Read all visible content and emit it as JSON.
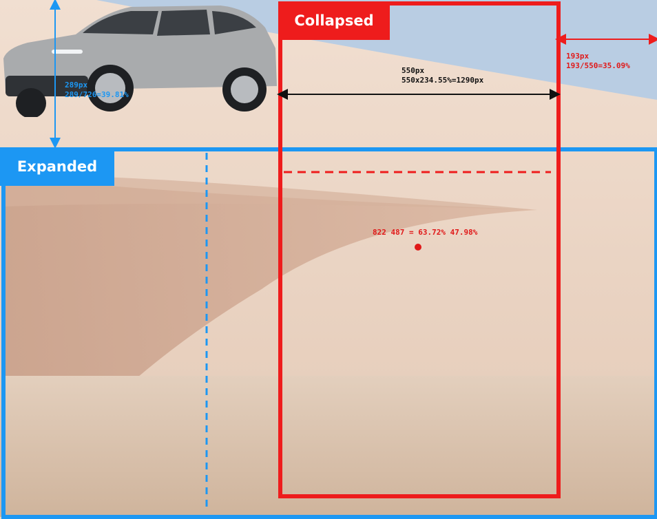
{
  "labels": {
    "collapsed": "Collapsed",
    "expanded": "Expanded"
  },
  "annotations": {
    "top_offset_px": "289px",
    "top_offset_ratio": "289/726=39.81%",
    "width_px": "550px",
    "width_scaled": "550x234.55%=1290px",
    "right_offset_px": "193px",
    "right_offset_ratio": "193/550=35.09%",
    "focal_point": "822 487 = 63.72% 47.98%"
  },
  "colors": {
    "expanded": "#1c97f3",
    "collapsed": "#ee1c1c",
    "sky": "#b9cde3",
    "wall": "#ecd6c6",
    "ground": "#dcc5b1",
    "car": "#a9abad"
  }
}
